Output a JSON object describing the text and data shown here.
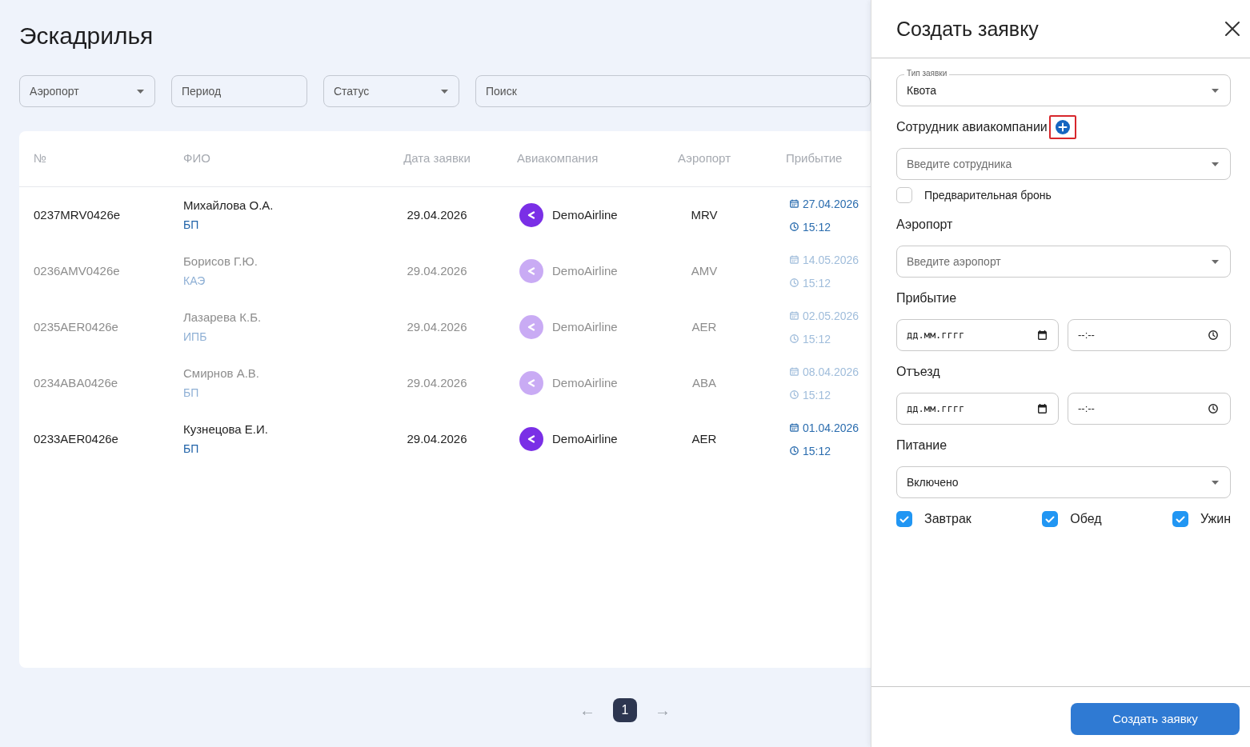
{
  "page_title": "Эскадрилья",
  "filters": [
    {
      "kind": "select",
      "placeholder": "Аэропорт"
    },
    {
      "kind": "input",
      "placeholder": "Период"
    },
    {
      "kind": "select",
      "placeholder": "Статус"
    },
    {
      "kind": "search",
      "placeholder": "Поиск"
    }
  ],
  "table": {
    "columns": [
      "№",
      "ФИО",
      "Дата заявки",
      "Авиакомпания",
      "Аэропорт",
      "Прибытие"
    ],
    "rows": [
      {
        "number": "0237MRV0426e",
        "name": "Михайлова О.А.",
        "category": "БП",
        "request_date": "29.04.2026",
        "airline": "DemoAirline",
        "airport": "MRV",
        "arrival_date": "27.04.2026",
        "arrival_time": "15:12",
        "dimmed": false
      },
      {
        "number": "0236AMV0426e",
        "name": "Борисов Г.Ю.",
        "category": "КАЭ",
        "request_date": "29.04.2026",
        "airline": "DemoAirline",
        "airport": "AMV",
        "arrival_date": "14.05.2026",
        "arrival_time": "15:12",
        "dimmed": true
      },
      {
        "number": "0235AER0426e",
        "name": "Лазарева К.Б.",
        "category": "ИПБ",
        "request_date": "29.04.2026",
        "airline": "DemoAirline",
        "airport": "AER",
        "arrival_date": "02.05.2026",
        "arrival_time": "15:12",
        "dimmed": true
      },
      {
        "number": "0234ABA0426e",
        "name": "Смирнов А.В.",
        "category": "БП",
        "request_date": "29.04.2026",
        "airline": "DemoAirline",
        "airport": "ABA",
        "arrival_date": "08.04.2026",
        "arrival_time": "15:12",
        "dimmed": true
      },
      {
        "number": "0233AER0426e",
        "name": "Кузнецова Е.И.",
        "category": "БП",
        "request_date": "29.04.2026",
        "airline": "DemoAirline",
        "airport": "AER",
        "arrival_date": "01.04.2026",
        "arrival_time": "15:12",
        "dimmed": false
      }
    ]
  },
  "pagination": {
    "previous": "←",
    "pages": [
      {
        "label": "1",
        "selected": true
      }
    ],
    "next": "→"
  },
  "request_form": {
    "title": "Создать заявку",
    "request_type": {
      "label": "Тип заявки",
      "value": "Квота"
    },
    "employee": {
      "label": "Сотрудник авиакомпании",
      "placeholder": "Введите сотрудника",
      "add_highlighted": true
    },
    "pre_booking": {
      "label": "Предварительная бронь",
      "checked": false
    },
    "airport": {
      "label": "Аэропорт",
      "placeholder": "Введите аэропорт"
    },
    "arrival": {
      "label": "Прибытие",
      "date_placeholder": "дд.мм.гггг",
      "time_placeholder": "--:--"
    },
    "departure": {
      "label": "Отъезд",
      "date_placeholder": "дд.мм.гггг",
      "time_placeholder": "--:--"
    },
    "meals": {
      "label": "Питание",
      "value": "Включено",
      "options": [
        {
          "label": "Завтрак",
          "checked": true
        },
        {
          "label": "Обед",
          "checked": true
        },
        {
          "label": "Ужин",
          "checked": true
        }
      ]
    },
    "submit": "Создать заявку"
  }
}
